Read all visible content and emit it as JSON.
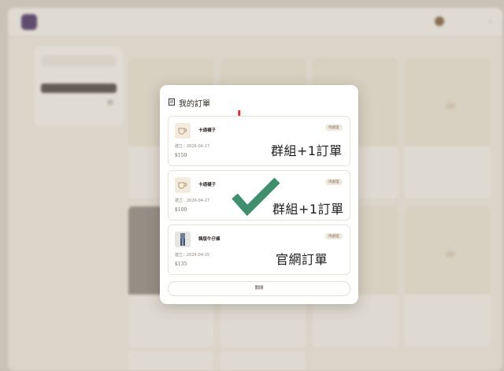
{
  "modal": {
    "title": "我的訂單",
    "annotation_mark": "L",
    "close_label": "關閉",
    "orders": [
      {
        "name": "卡通襪子",
        "status": "待處理",
        "date": "建立：2026-04-17",
        "price": "$150",
        "annotation": "群組+1訂單",
        "thumb_icon": "cup-icon"
      },
      {
        "name": "卡通襪子",
        "status": "待處理",
        "date": "建立：2026-04-17",
        "price": "$100",
        "annotation": "群組+1訂單",
        "thumb_icon": "cup-icon"
      },
      {
        "name": "韓版牛仔褲",
        "status": "待處理",
        "date": "建立：2026-04-15",
        "price": "$135",
        "annotation": "官網訂單",
        "thumb_icon": "product-photo"
      }
    ]
  },
  "colors": {
    "accent_check": "#3f8f6f",
    "annotation_red": "#e02a2a",
    "background": "#efe9df"
  }
}
